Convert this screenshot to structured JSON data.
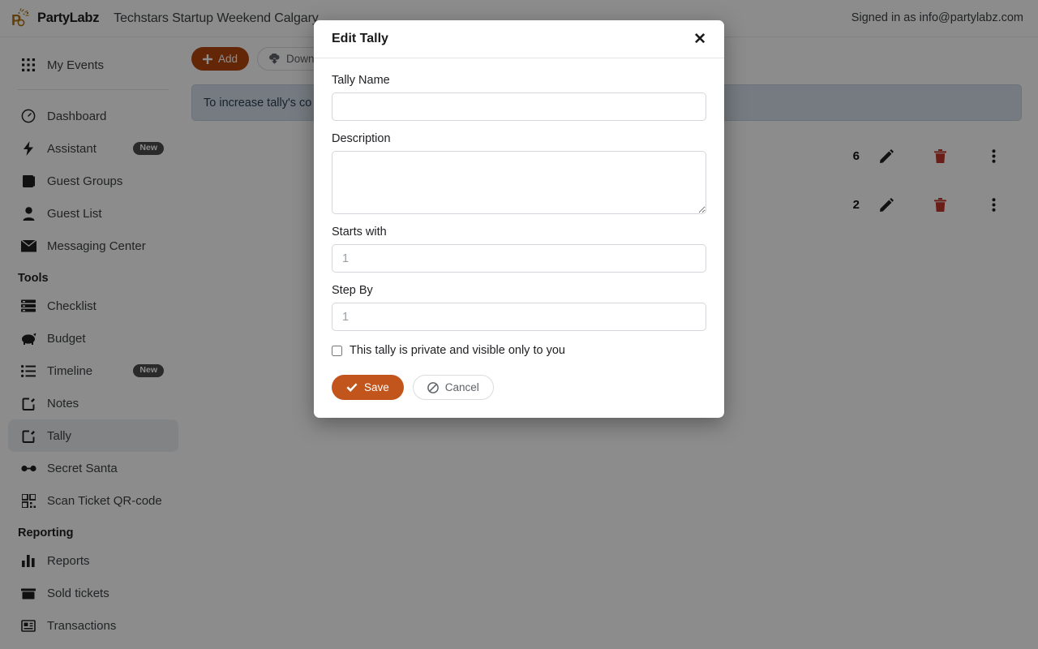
{
  "header": {
    "brand_part1": "Party",
    "brand_part2": "Labz",
    "logo_icon": "partylabz-confetti-logo",
    "event_title": "Techstars Startup Weekend Calgary",
    "signed_in": "Signed in as info@partylabz.com"
  },
  "sidebar": {
    "top": [
      {
        "label": "My Events",
        "icon": "grid-apps-icon",
        "badge": null,
        "active": false
      }
    ],
    "primary": [
      {
        "label": "Dashboard",
        "icon": "gauge-icon",
        "badge": null,
        "active": false
      },
      {
        "label": "Assistant",
        "icon": "lightning-bolt-icon",
        "badge": "New",
        "active": false
      },
      {
        "label": "Guest Groups",
        "icon": "book-icon",
        "badge": null,
        "active": false
      },
      {
        "label": "Guest List",
        "icon": "person-icon",
        "badge": null,
        "active": false
      },
      {
        "label": "Messaging Center",
        "icon": "envelope-icon",
        "badge": null,
        "active": false
      }
    ],
    "tools_heading": "Tools",
    "tools": [
      {
        "label": "Checklist",
        "icon": "checklist-icon",
        "badge": null,
        "active": false
      },
      {
        "label": "Budget",
        "icon": "piggy-bank-icon",
        "badge": null,
        "active": false
      },
      {
        "label": "Timeline",
        "icon": "list-icon",
        "badge": "New",
        "active": false
      },
      {
        "label": "Notes",
        "icon": "pencil-square-icon",
        "badge": null,
        "active": false
      },
      {
        "label": "Tally",
        "icon": "pencil-square-icon",
        "badge": null,
        "active": true
      },
      {
        "label": "Secret Santa",
        "icon": "glasses-icon",
        "badge": null,
        "active": false
      },
      {
        "label": "Scan Ticket QR-code",
        "icon": "qr-code-icon",
        "badge": null,
        "active": false
      }
    ],
    "reporting_heading": "Reporting",
    "reporting": [
      {
        "label": "Reports",
        "icon": "bar-chart-icon",
        "badge": null,
        "active": false
      },
      {
        "label": "Sold tickets",
        "icon": "ticket-box-icon",
        "badge": null,
        "active": false
      },
      {
        "label": "Transactions",
        "icon": "receipt-icon",
        "badge": null,
        "active": false
      }
    ]
  },
  "main": {
    "toolbar": {
      "add_label": "Add",
      "add_icon": "plus-icon",
      "download_label": "Download",
      "download_icon": "cloud-download-icon"
    },
    "alert_text": "To increase tally's co",
    "rows": [
      {
        "count": "6",
        "edit_icon": "pencil-icon",
        "delete_icon": "trash-icon",
        "more_icon": "three-dots-vertical-icon"
      },
      {
        "count": "2",
        "edit_icon": "pencil-icon",
        "delete_icon": "trash-icon",
        "more_icon": "three-dots-vertical-icon"
      }
    ]
  },
  "modal": {
    "title": "Edit Tally",
    "close_icon": "close-icon",
    "tally_name_label": "Tally Name",
    "tally_name_value": "",
    "tally_name_placeholder": "",
    "description_label": "Description",
    "description_value": "",
    "description_placeholder": "",
    "starts_with_label": "Starts with",
    "starts_with_value": "",
    "starts_with_placeholder": "1",
    "step_by_label": "Step By",
    "step_by_value": "",
    "step_by_placeholder": "1",
    "private_checkbox_label": "This tally is private and visible only to you",
    "private_checked": false,
    "save_label": "Save",
    "save_icon": "check-icon",
    "cancel_label": "Cancel",
    "cancel_icon": "ban-icon"
  },
  "colors": {
    "accent": "#c2551c",
    "add_button": "#b5470f",
    "delete_icon": "#c0392b",
    "alert_bg": "#d6e0ea",
    "badge_bg": "#4e4e4e"
  }
}
